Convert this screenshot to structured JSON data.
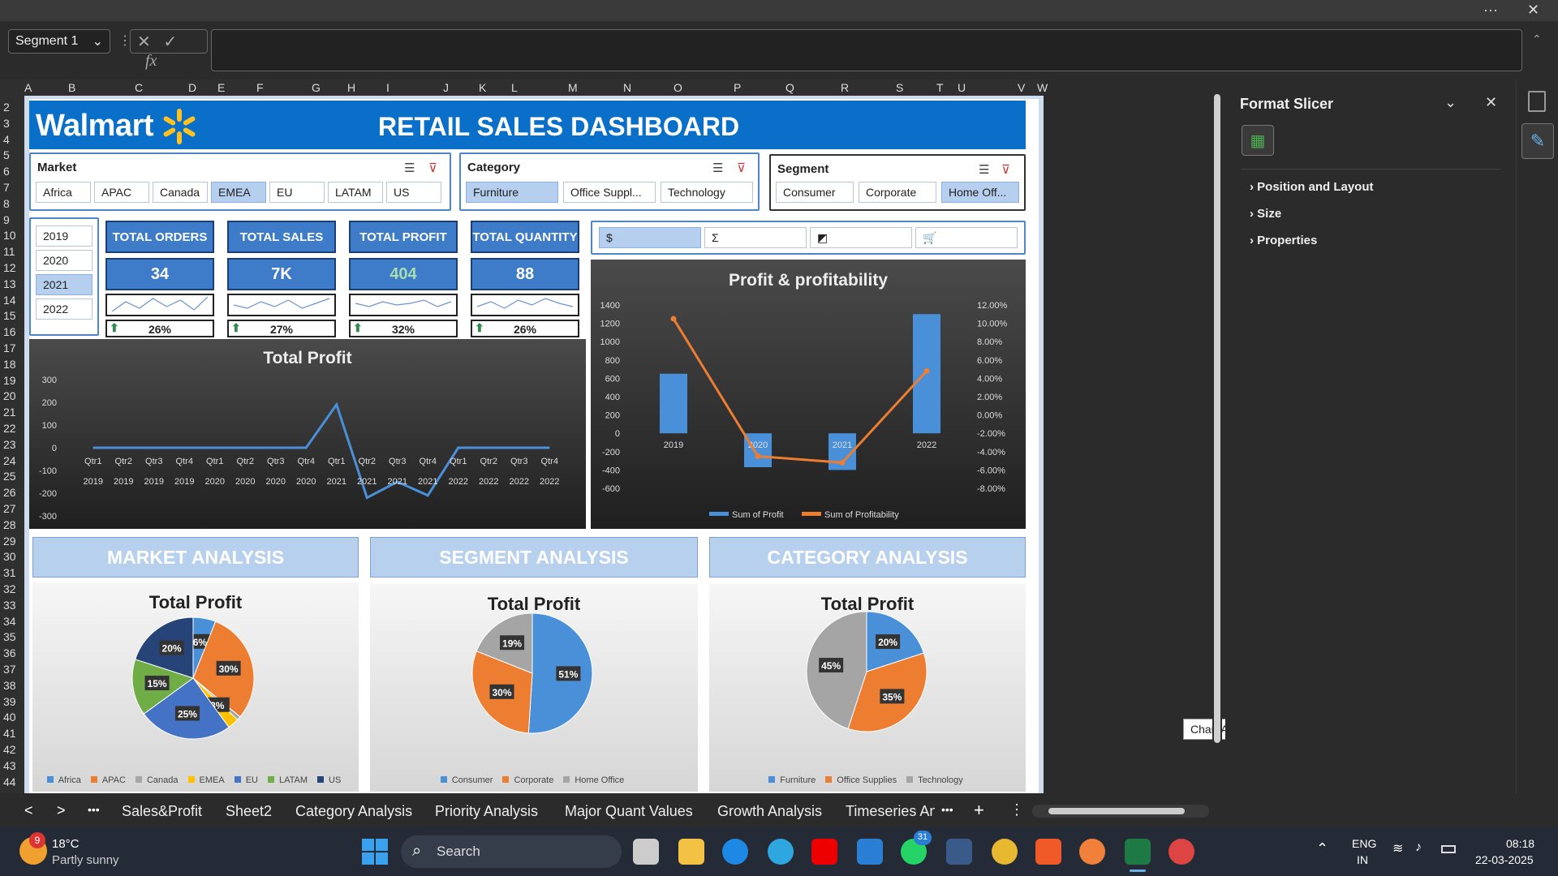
{
  "titlebar": {
    "more": "···",
    "close": "✕"
  },
  "formula_bar": {
    "name_box": "Segment 1",
    "cancel": "✕",
    "enter": "✓",
    "fx": "fx",
    "value": ""
  },
  "columns": [
    "A",
    "B",
    "C",
    "D",
    "E",
    "F",
    "G",
    "H",
    "I",
    "J",
    "K",
    "L",
    "M",
    "N",
    "O",
    "P",
    "Q",
    "R",
    "S",
    "T",
    "U",
    "V",
    "W"
  ],
  "rows": [
    "2",
    "3",
    "4",
    "5",
    "6",
    "7",
    "8",
    "9",
    "10",
    "11",
    "12",
    "13",
    "14",
    "15",
    "16",
    "17",
    "18",
    "19",
    "20",
    "21",
    "22",
    "23",
    "24",
    "25",
    "26",
    "27",
    "28",
    "29",
    "30",
    "31",
    "32",
    "33",
    "34",
    "35",
    "36",
    "37",
    "38",
    "39",
    "40",
    "41",
    "42",
    "43",
    "44"
  ],
  "dashboard": {
    "logo": "Walmart",
    "title": "RETAIL SALES DASHBOARD",
    "market": {
      "label": "Market",
      "items": [
        "Africa",
        "APAC",
        "Canada",
        "EMEA",
        "EU",
        "LATAM",
        "US"
      ],
      "selected": "EMEA"
    },
    "category": {
      "label": "Category",
      "items": [
        "Furniture",
        "Office Suppl...",
        "Technology"
      ],
      "selected": "Furniture"
    },
    "segment": {
      "label": "Segment",
      "items": [
        "Consumer",
        "Corporate",
        "Home Off..."
      ],
      "selected": "Home Off..."
    },
    "years": {
      "items": [
        "2019",
        "2020",
        "2021",
        "2022"
      ],
      "selected": "2021"
    },
    "kpis": [
      {
        "label": "TOTAL ORDERS",
        "value": "34",
        "pct": "26%"
      },
      {
        "label": "TOTAL SALES",
        "value": "7K",
        "pct": "27%"
      },
      {
        "label": "TOTAL PROFIT",
        "value": "404",
        "pct": "32%"
      },
      {
        "label": "TOTAL QUANTITY",
        "value": "88",
        "pct": "26%"
      }
    ],
    "icon_slicer": [
      "$",
      "Σ",
      "chart",
      "cart"
    ],
    "sections": [
      "MARKET ANALYSIS",
      "SEGMENT ANALYSIS",
      "CATEGORY ANALYSIS"
    ]
  },
  "chart_data": [
    {
      "type": "line",
      "title": "Total Profit",
      "x": [
        "Qtr1 2019",
        "Qtr2 2019",
        "Qtr3 2019",
        "Qtr4 2019",
        "Qtr1 2020",
        "Qtr2 2020",
        "Qtr3 2020",
        "Qtr4 2020",
        "Qtr1 2021",
        "Qtr2 2021",
        "Qtr3 2021",
        "Qtr4 2021",
        "Qtr1 2022",
        "Qtr2 2022",
        "Qtr3 2022",
        "Qtr4 2022"
      ],
      "quarters": [
        "Qtr1",
        "Qtr2",
        "Qtr3",
        "Qtr4",
        "Qtr1",
        "Qtr2",
        "Qtr3",
        "Qtr4",
        "Qtr1",
        "Qtr2",
        "Qtr3",
        "Qtr4",
        "Qtr1",
        "Qtr2",
        "Qtr3",
        "Qtr4"
      ],
      "years": [
        "2019",
        "2019",
        "2019",
        "2019",
        "2020",
        "2020",
        "2020",
        "2020",
        "2021",
        "2021",
        "2021",
        "2021",
        "2022",
        "2022",
        "2022",
        "2022"
      ],
      "values": [
        0,
        0,
        0,
        0,
        0,
        0,
        0,
        0,
        190,
        -220,
        -150,
        -210,
        0,
        0,
        0,
        0
      ],
      "yticks": [
        300,
        200,
        100,
        0,
        -100,
        -200,
        -300
      ],
      "ylim": [
        -300,
        300
      ],
      "color": "#4a90d9"
    },
    {
      "type": "bar",
      "title": "Profit & profitability",
      "categories": [
        "2019",
        "2020",
        "2021",
        "2022"
      ],
      "series": [
        {
          "name": "Sum of Profit",
          "values": [
            650,
            -370,
            -400,
            1300
          ],
          "color": "#4a90d9"
        },
        {
          "name": "Sum of Profitability",
          "values": [
            10.5,
            -4.5,
            -5.2,
            4.8
          ],
          "color": "#ed7d31",
          "axis": "right"
        }
      ],
      "yticks_left": [
        1400,
        1200,
        1000,
        800,
        600,
        400,
        200,
        0,
        -200,
        -400,
        -600
      ],
      "ylim": [
        -600,
        1400
      ],
      "yticks_right": [
        "12.00%",
        "10.00%",
        "8.00%",
        "6.00%",
        "4.00%",
        "2.00%",
        "0.00%",
        "-2.00%",
        "-4.00%",
        "-6.00%",
        "-8.00%"
      ],
      "y2lim": [
        -8,
        12
      ]
    },
    {
      "type": "pie",
      "title": "Total Profit",
      "labels": [
        "Africa",
        "APAC",
        "Canada",
        "EMEA",
        "EU",
        "LATAM",
        "US"
      ],
      "values": [
        6,
        30,
        1,
        3,
        25,
        15,
        20
      ],
      "display": [
        "6%",
        "30%",
        "",
        "3%",
        "25%",
        "15%",
        "20%"
      ],
      "colors": [
        "#4a90d9",
        "#ed7d31",
        "#a5a5a5",
        "#ffc000",
        "#4472c4",
        "#70ad47",
        "#264478"
      ]
    },
    {
      "type": "pie",
      "title": "Total Profit",
      "labels": [
        "Consumer",
        "Corporate",
        "Home Office"
      ],
      "values": [
        51,
        30,
        19
      ],
      "display": [
        "51%",
        "30%",
        "19%"
      ],
      "colors": [
        "#4a90d9",
        "#ed7d31",
        "#a5a5a5"
      ]
    },
    {
      "type": "pie",
      "title": "Total Profit",
      "labels": [
        "Furniture",
        "Office Supplies",
        "Technology"
      ],
      "values": [
        20,
        35,
        45
      ],
      "display": [
        "20%",
        "35%",
        "45%"
      ],
      "colors": [
        "#4a90d9",
        "#ed7d31",
        "#a5a5a5"
      ]
    }
  ],
  "pane": {
    "title": "Format Slicer",
    "items": [
      "Position and Layout",
      "Size",
      "Properties"
    ]
  },
  "tooltip": "Chart Area",
  "tabs": [
    "Sales&Profit",
    "Sheet2",
    "Category Analysis",
    "Priority Analysis",
    "Major Quant Values",
    "Growth Analysis",
    "Timeseries An"
  ],
  "tab_controls": {
    "prev": "<",
    "next": ">",
    "more": "•••",
    "more2": "•••",
    "add": "+",
    "menu": "⋮"
  },
  "taskbar": {
    "temp": "18°C",
    "weather": "Partly sunny",
    "badge": "9",
    "search": "Search",
    "lang1": "ENG",
    "lang2": "IN",
    "time": "08:18",
    "date": "22-03-2025",
    "chat_badge": "31"
  }
}
